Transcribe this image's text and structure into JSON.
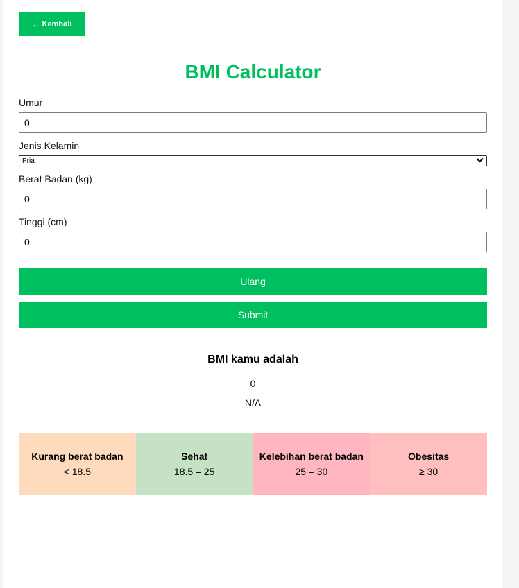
{
  "nav": {
    "back_label": "Kembali"
  },
  "title": "BMI Calculator",
  "form": {
    "age": {
      "label": "Umur",
      "value": "0"
    },
    "gender": {
      "label": "Jenis Kelamin",
      "value": "Pria"
    },
    "weight": {
      "label": "Berat Badan (kg)",
      "value": "0"
    },
    "height": {
      "label": "Tinggi (cm)",
      "value": "0"
    }
  },
  "buttons": {
    "reset": "Ulang",
    "submit": "Submit"
  },
  "result": {
    "heading": "BMI kamu adalah",
    "value": "0",
    "category": "N/A"
  },
  "categories": [
    {
      "name": "Kurang berat badan",
      "range": "< 18.5",
      "color": "#fedbbd"
    },
    {
      "name": "Sehat",
      "range": "18.5 – 25",
      "color": "#c6e2c4"
    },
    {
      "name": "Kelebihan berat badan",
      "range": "25 – 30",
      "color": "#ffb6c0"
    },
    {
      "name": "Obesitas",
      "range": "≥ 30",
      "color": "#ffbfbf"
    }
  ],
  "colors": {
    "accent": "#00bf5f"
  }
}
